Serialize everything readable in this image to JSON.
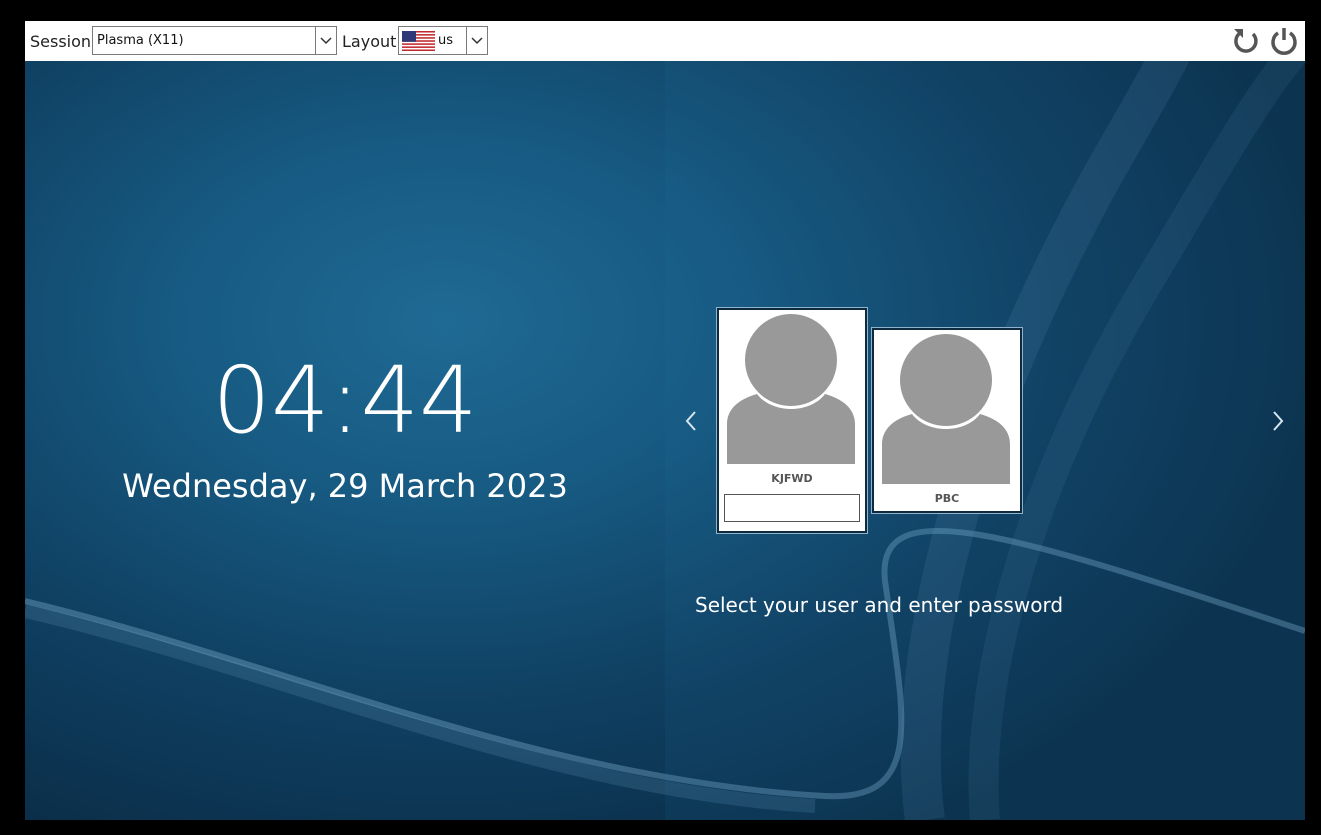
{
  "topbar": {
    "session_label": "Session",
    "session_value": "Plasma (X11)",
    "layout_label": "Layout",
    "layout_value": "us",
    "layout_flag": "us-flag-icon",
    "restart_icon": "restart-icon",
    "shutdown_icon": "power-icon"
  },
  "clock": {
    "time": "04:44",
    "date": "Wednesday, 29 March 2023"
  },
  "users": [
    {
      "name": "KJFWD",
      "selected": true
    },
    {
      "name": "PBC",
      "selected": false
    }
  ],
  "password": {
    "value": ""
  },
  "instruction": "Select your user and enter password",
  "colors": {
    "background_dark": "#0a2c46",
    "background_mid": "#175a82",
    "avatar_gray": "#999999",
    "topbar": "#ffffff"
  }
}
